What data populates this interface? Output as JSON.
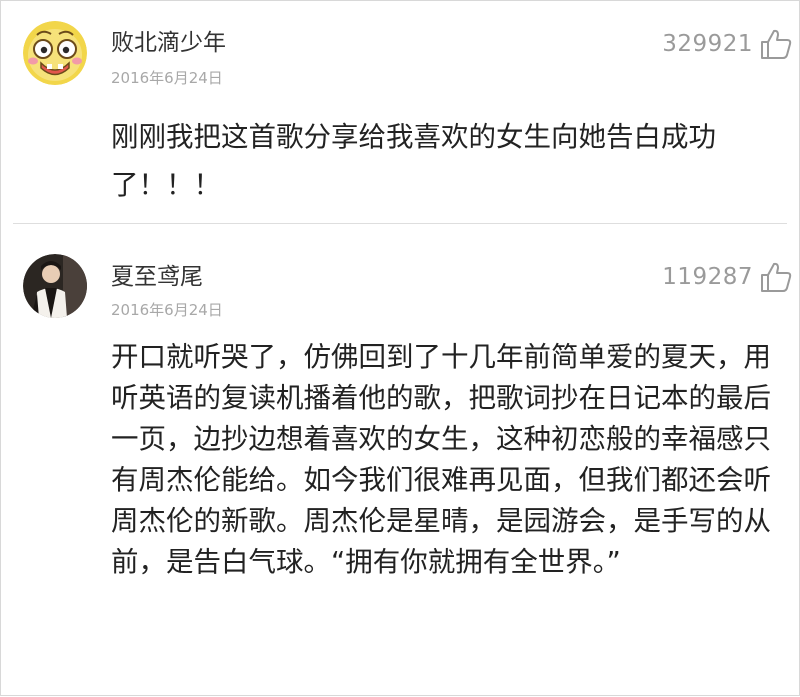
{
  "comments": [
    {
      "username": "败北滴少年",
      "date": "2016年6月24日",
      "likes": "329921",
      "avatar_icon": "cartoon-face-avatar",
      "text": "刚刚我把这首歌分享给我喜欢的女生向她告白成功了！！！"
    },
    {
      "username": "夏至鸢尾",
      "date": "2016年6月24日",
      "likes": "119287",
      "avatar_icon": "photo-avatar",
      "text": "开口就听哭了，仿佛回到了十几年前简单爱的夏天，用听英语的复读机播着他的歌，把歌词抄在日记本的最后一页，边抄边想着喜欢的女生，这种初恋般的幸福感只有周杰伦能给。如今我们很难再见面，但我们都还会听周杰伦的新歌。周杰伦是星晴，是园游会，是手写的从前，是告白气球。“拥有你就拥有全世界。”"
    }
  ],
  "colors": {
    "username": "#333333",
    "date": "#a8a8a8",
    "like_count": "#9a9a9a",
    "body_text": "#222222",
    "divider": "#dedede"
  }
}
